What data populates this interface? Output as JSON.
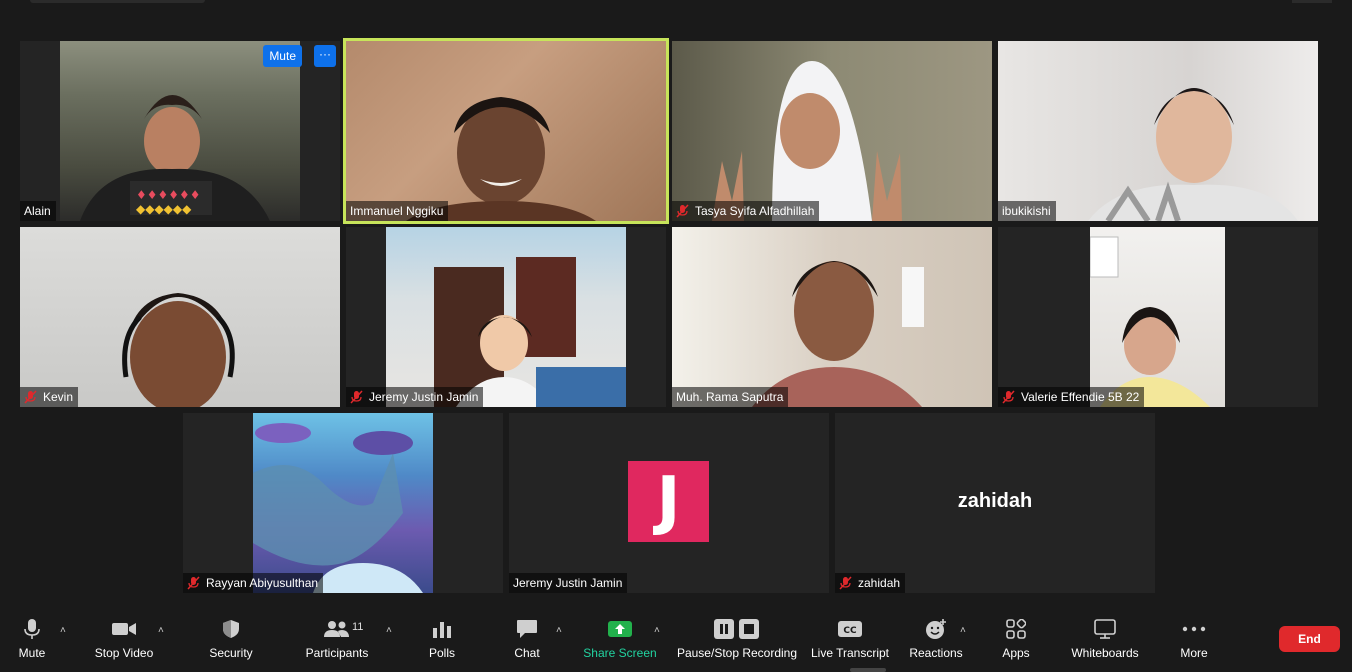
{
  "participants": [
    {
      "name": "Alain",
      "muted": false
    },
    {
      "name": "Immanuel Nggiku",
      "muted": false,
      "speaking": true
    },
    {
      "name": "Tasya Syifa Alfadhillah",
      "muted": true
    },
    {
      "name": "ibukikishi",
      "muted": false
    },
    {
      "name": "Kevin",
      "muted": true
    },
    {
      "name": "Jeremy Justin Jamin",
      "muted": true
    },
    {
      "name": "Muh. Rama Saputra",
      "muted": false
    },
    {
      "name": "Valerie Effendie 5B 22",
      "muted": true
    },
    {
      "name": "Rayyan Abiyusulthan",
      "muted": true
    },
    {
      "name": "Jeremy Justin Jamin",
      "muted": false,
      "avatar_letter": "J"
    },
    {
      "name": "zahidah",
      "muted": true,
      "display_name": "zahidah"
    }
  ],
  "tile_controls": {
    "mute_label": "Mute",
    "more_label": "···"
  },
  "toolbar": {
    "mute": "Mute",
    "stop_video": "Stop Video",
    "security": "Security",
    "participants": "Participants",
    "participants_count": "11",
    "polls": "Polls",
    "chat": "Chat",
    "share_screen": "Share Screen",
    "recording": "Pause/Stop Recording",
    "live_transcript": "Live Transcript",
    "reactions": "Reactions",
    "apps": "Apps",
    "whiteboards": "Whiteboards",
    "more": "More",
    "end": "End",
    "cc_label": "CC"
  },
  "colors": {
    "active_speaker": "#c7e45a",
    "share_green": "#22d3a0",
    "end_red": "#e0292c",
    "avatar_pink": "#e0285f",
    "button_blue": "#0e71eb"
  }
}
